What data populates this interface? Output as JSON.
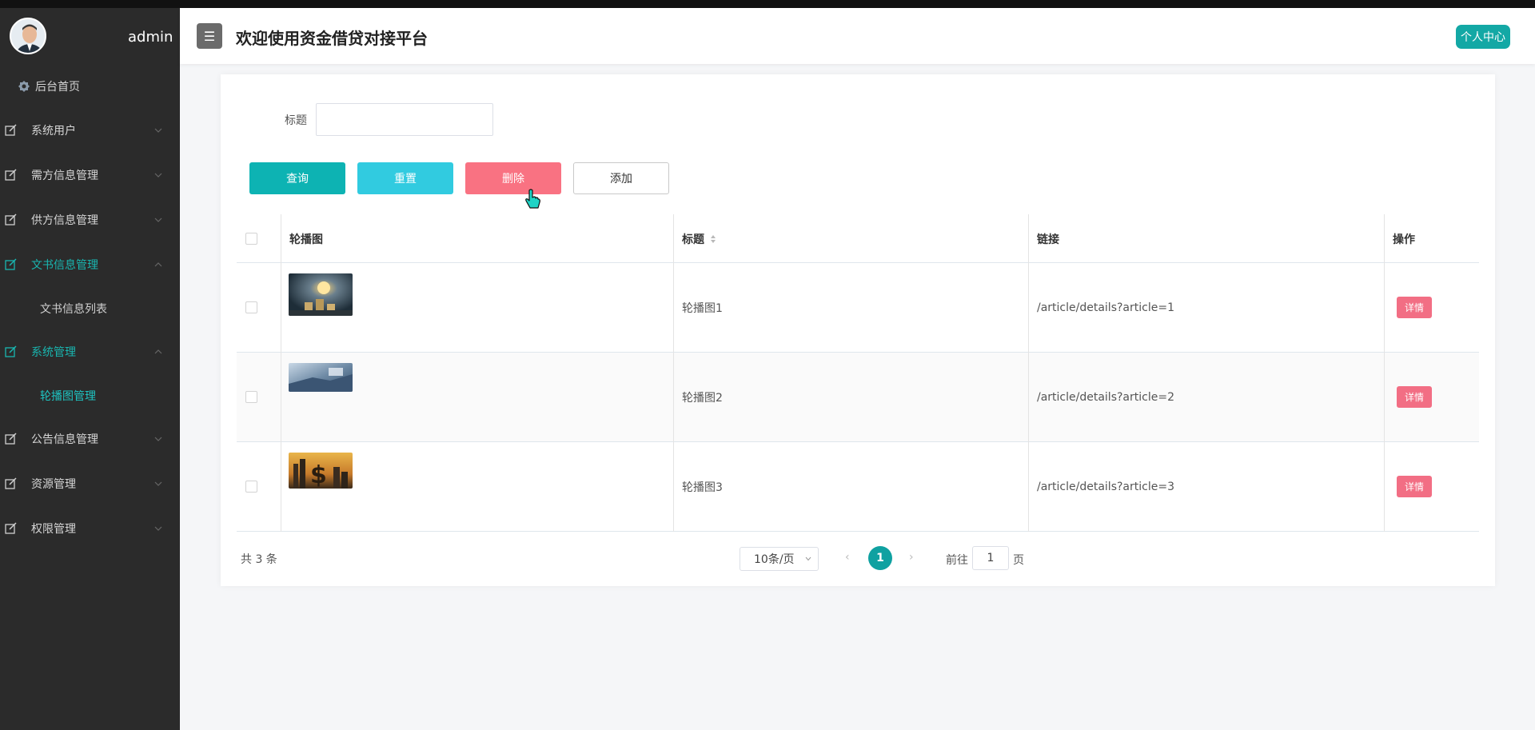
{
  "sidebar": {
    "username": "admin",
    "home": "后台首页",
    "menu": [
      {
        "label": "系统用户",
        "expanded": false
      },
      {
        "label": "需方信息管理",
        "expanded": false
      },
      {
        "label": "供方信息管理",
        "expanded": false
      },
      {
        "label": "文书信息管理",
        "expanded": true,
        "children": [
          "文书信息列表"
        ]
      },
      {
        "label": "系统管理",
        "expanded": true,
        "children": [
          "轮播图管理"
        ]
      },
      {
        "label": "公告信息管理",
        "expanded": false
      },
      {
        "label": "资源管理",
        "expanded": false
      },
      {
        "label": "权限管理",
        "expanded": false
      }
    ]
  },
  "header": {
    "menu_icon": "☰",
    "title": "欢迎使用资金借贷对接平台",
    "profile_label": "个人中心"
  },
  "filter": {
    "title_label": "标题",
    "title_value": ""
  },
  "actions": {
    "query": "查询",
    "reset": "重置",
    "delete": "删除",
    "add": "添加"
  },
  "table": {
    "columns": [
      "轮播图",
      "标题",
      "链接",
      "操作"
    ],
    "rows": [
      {
        "title": "轮播图1",
        "link": "/article/details?article=1",
        "action": "详情"
      },
      {
        "title": "轮播图2",
        "link": "/article/details?article=2",
        "action": "详情"
      },
      {
        "title": "轮播图3",
        "link": "/article/details?article=3",
        "action": "详情"
      }
    ]
  },
  "pagination": {
    "total": "共 3 条",
    "page_size": "10条/页",
    "prev": "‹",
    "next": "›",
    "current_page": "1",
    "goto_label": "前往",
    "goto_value": "1",
    "goto_suffix": "页"
  },
  "colors": {
    "accent": "#13a8a5",
    "sidebar_bg": "#2b2b2b",
    "delete": "#f97282",
    "reset": "#31cbe0"
  }
}
